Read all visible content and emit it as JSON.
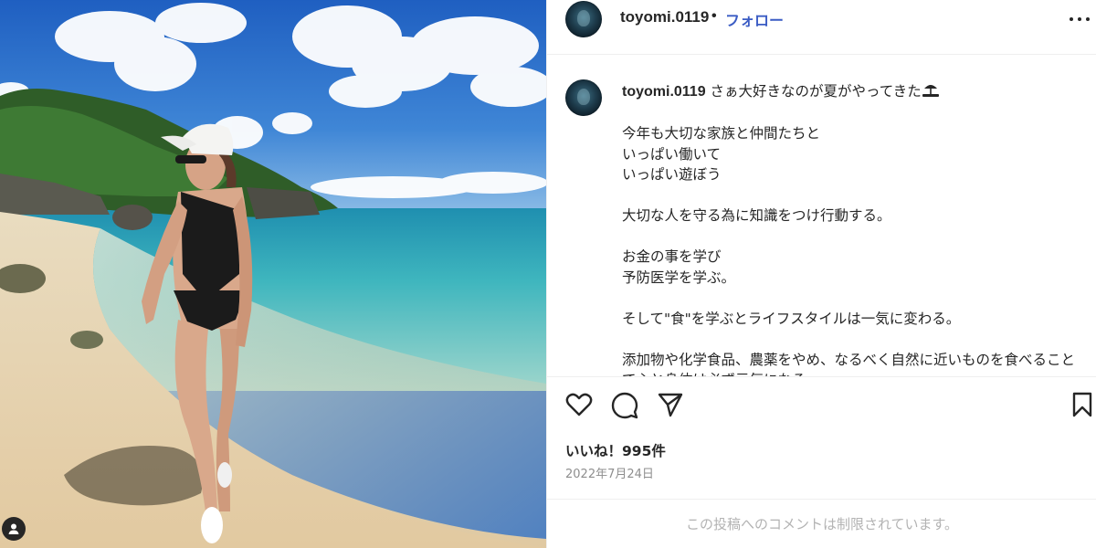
{
  "post": {
    "username": "toyomi.0119",
    "separator": "•",
    "follow_label": "フォロー",
    "caption": {
      "first_line": " さぁ大好きなのが夏がやってきた",
      "emoji_icon": "beach-umbrella-icon",
      "paragraphs": [
        [
          "今年も大切な家族と仲間たちと",
          "いっぱい働いて",
          "いっぱい遊ぼう"
        ],
        [
          "大切な人を守る為に知識をつけ行動する。"
        ],
        [
          "お金の事を学び",
          "予防医学を学ぶ。"
        ],
        [
          "そして\"食\"を学ぶとライフスタイルは一気に変わる。"
        ],
        [
          "添加物や化学食品、農薬をやめ、なるべく自然に近いものを食べることで心と身体は必ず元気になる"
        ]
      ]
    },
    "likes_label": "いいね！995件",
    "date": "2022年7月24日",
    "comments_notice": "この投稿へのコメントは制限されています。",
    "icons": [
      "heart-icon",
      "comment-icon",
      "share-icon",
      "bookmark-icon",
      "more-icon",
      "user-tag-icon"
    ]
  },
  "colors": {
    "follow": "#3b5cc4",
    "text": "#262626",
    "muted": "#8e8e8e",
    "border": "#efefef"
  }
}
